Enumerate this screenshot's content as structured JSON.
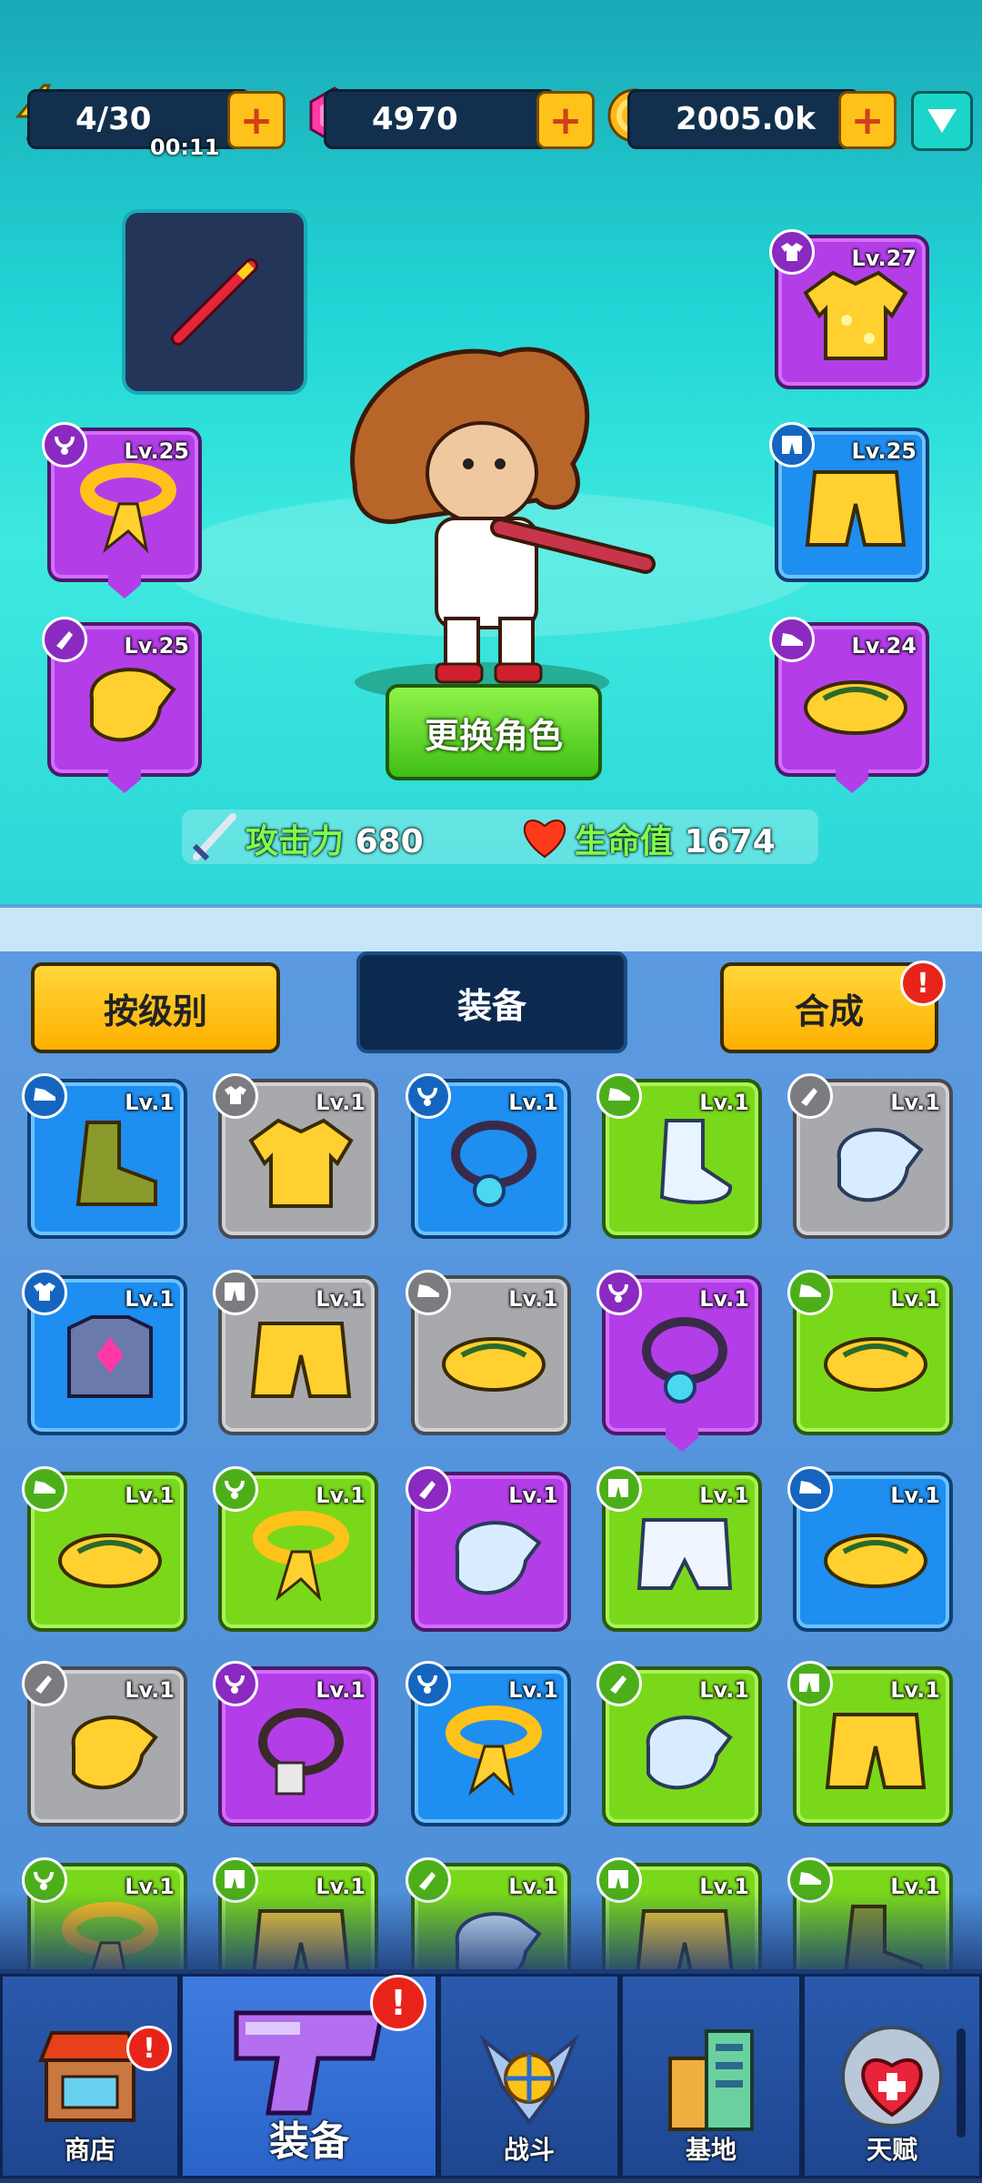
{
  "resources": {
    "energy": "4/30",
    "energy_timer": "00:11",
    "gems": "4970",
    "coins": "2005.0k"
  },
  "character_button": "更换角色",
  "stats": {
    "attack_label": "攻击力",
    "attack_value": "680",
    "hp_label": "生命值",
    "hp_value": "1674"
  },
  "equipped": [
    {
      "slot": "top",
      "level": "Lv.27",
      "rarity": "purple",
      "item": "shirt"
    },
    {
      "slot": "pants",
      "level": "Lv.25",
      "rarity": "blue",
      "item": "shorts"
    },
    {
      "slot": "necklace",
      "level": "Lv.25",
      "rarity": "purple",
      "item": "scarf"
    },
    {
      "slot": "gloves",
      "level": "Lv.25",
      "rarity": "purple",
      "item": "glove"
    },
    {
      "slot": "shoes",
      "level": "Lv.24",
      "rarity": "purple",
      "item": "sandal"
    }
  ],
  "tabs": {
    "sort": "按级别",
    "title": "装备",
    "merge": "合成"
  },
  "inventory": [
    {
      "level": "Lv.1",
      "rarity": "blue",
      "item": "boot",
      "cat": "shoes"
    },
    {
      "level": "Lv.1",
      "rarity": "grey",
      "item": "shirt",
      "cat": "top"
    },
    {
      "level": "Lv.1",
      "rarity": "blue",
      "item": "necklace",
      "cat": "necklace"
    },
    {
      "level": "Lv.1",
      "rarity": "green",
      "item": "sock",
      "cat": "shoes"
    },
    {
      "level": "Lv.1",
      "rarity": "grey",
      "item": "glove-white",
      "cat": "gloves"
    },
    {
      "level": "Lv.1",
      "rarity": "blue",
      "item": "armor",
      "cat": "top"
    },
    {
      "level": "Lv.1",
      "rarity": "grey",
      "item": "shorts",
      "cat": "pants"
    },
    {
      "level": "Lv.1",
      "rarity": "grey",
      "item": "sandal",
      "cat": "shoes"
    },
    {
      "level": "Lv.1",
      "rarity": "purple",
      "item": "necklace",
      "cat": "necklace"
    },
    {
      "level": "Lv.1",
      "rarity": "green",
      "item": "sandal",
      "cat": "shoes"
    },
    {
      "level": "Lv.1",
      "rarity": "green",
      "item": "sandal",
      "cat": "shoes"
    },
    {
      "level": "Lv.1",
      "rarity": "green",
      "item": "scarf",
      "cat": "necklace"
    },
    {
      "level": "Lv.1",
      "rarity": "purple",
      "item": "glove-white",
      "cat": "gloves"
    },
    {
      "level": "Lv.1",
      "rarity": "green",
      "item": "briefs",
      "cat": "pants"
    },
    {
      "level": "Lv.1",
      "rarity": "blue",
      "item": "sandal",
      "cat": "shoes"
    },
    {
      "level": "Lv.1",
      "rarity": "grey",
      "item": "glove-yellow",
      "cat": "gloves"
    },
    {
      "level": "Lv.1",
      "rarity": "purple",
      "item": "tag-necklace",
      "cat": "necklace"
    },
    {
      "level": "Lv.1",
      "rarity": "blue",
      "item": "scarf",
      "cat": "necklace"
    },
    {
      "level": "Lv.1",
      "rarity": "green",
      "item": "glove-white",
      "cat": "gloves"
    },
    {
      "level": "Lv.1",
      "rarity": "green",
      "item": "shorts",
      "cat": "pants"
    },
    {
      "level": "Lv.1",
      "rarity": "green",
      "item": "scarf",
      "cat": "necklace"
    },
    {
      "level": "Lv.1",
      "rarity": "green",
      "item": "shorts",
      "cat": "pants"
    },
    {
      "level": "Lv.1",
      "rarity": "green",
      "item": "glove-white",
      "cat": "gloves"
    },
    {
      "level": "Lv.1",
      "rarity": "green",
      "item": "shorts",
      "cat": "pants"
    },
    {
      "level": "Lv.1",
      "rarity": "green",
      "item": "boot",
      "cat": "shoes"
    }
  ],
  "nav": {
    "shop": "商店",
    "equipment": "装备",
    "battle": "战斗",
    "base": "基地",
    "talent": "天赋"
  },
  "colors": {
    "purple": "#b33ee8",
    "blue": "#1e8ef0",
    "green": "#7ad81a",
    "grey": "#a7a9ad"
  }
}
